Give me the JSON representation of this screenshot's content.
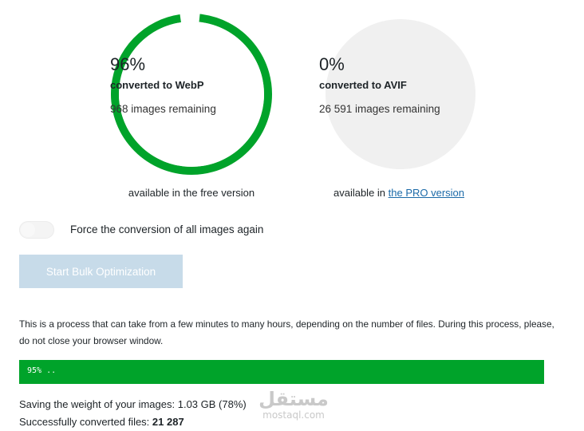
{
  "webp": {
    "percent": 96,
    "percent_label": "96%",
    "converted_label": "converted to WebP",
    "remaining_label": "968 images remaining",
    "availability": "available in the free version",
    "ring_color": "#00a32a"
  },
  "avif": {
    "percent": 0,
    "percent_label": "0%",
    "converted_label": "converted to AVIF",
    "remaining_label": "26 591 images remaining",
    "availability_prefix": "available in ",
    "availability_link": "the PRO version"
  },
  "force_toggle": {
    "label": "Force the conversion of all images again",
    "checked": false
  },
  "start_button": {
    "label": "Start Bulk Optimization",
    "disabled": true
  },
  "description": "This is a process that can take from a few minutes to many hours, depending on the number of files. During this process, please, do not close your browser window.",
  "progress": {
    "text": "95% ..",
    "fill_percent": 100,
    "color": "#00a32a"
  },
  "stats": {
    "saving_label": "Saving the weight of your images: ",
    "saving_value": "1.03 GB (78%)",
    "converted_label": "Successfully converted files: ",
    "converted_value": "21 287"
  },
  "watermark": {
    "arabic": "مستقل",
    "latin": "mostaql.com"
  }
}
